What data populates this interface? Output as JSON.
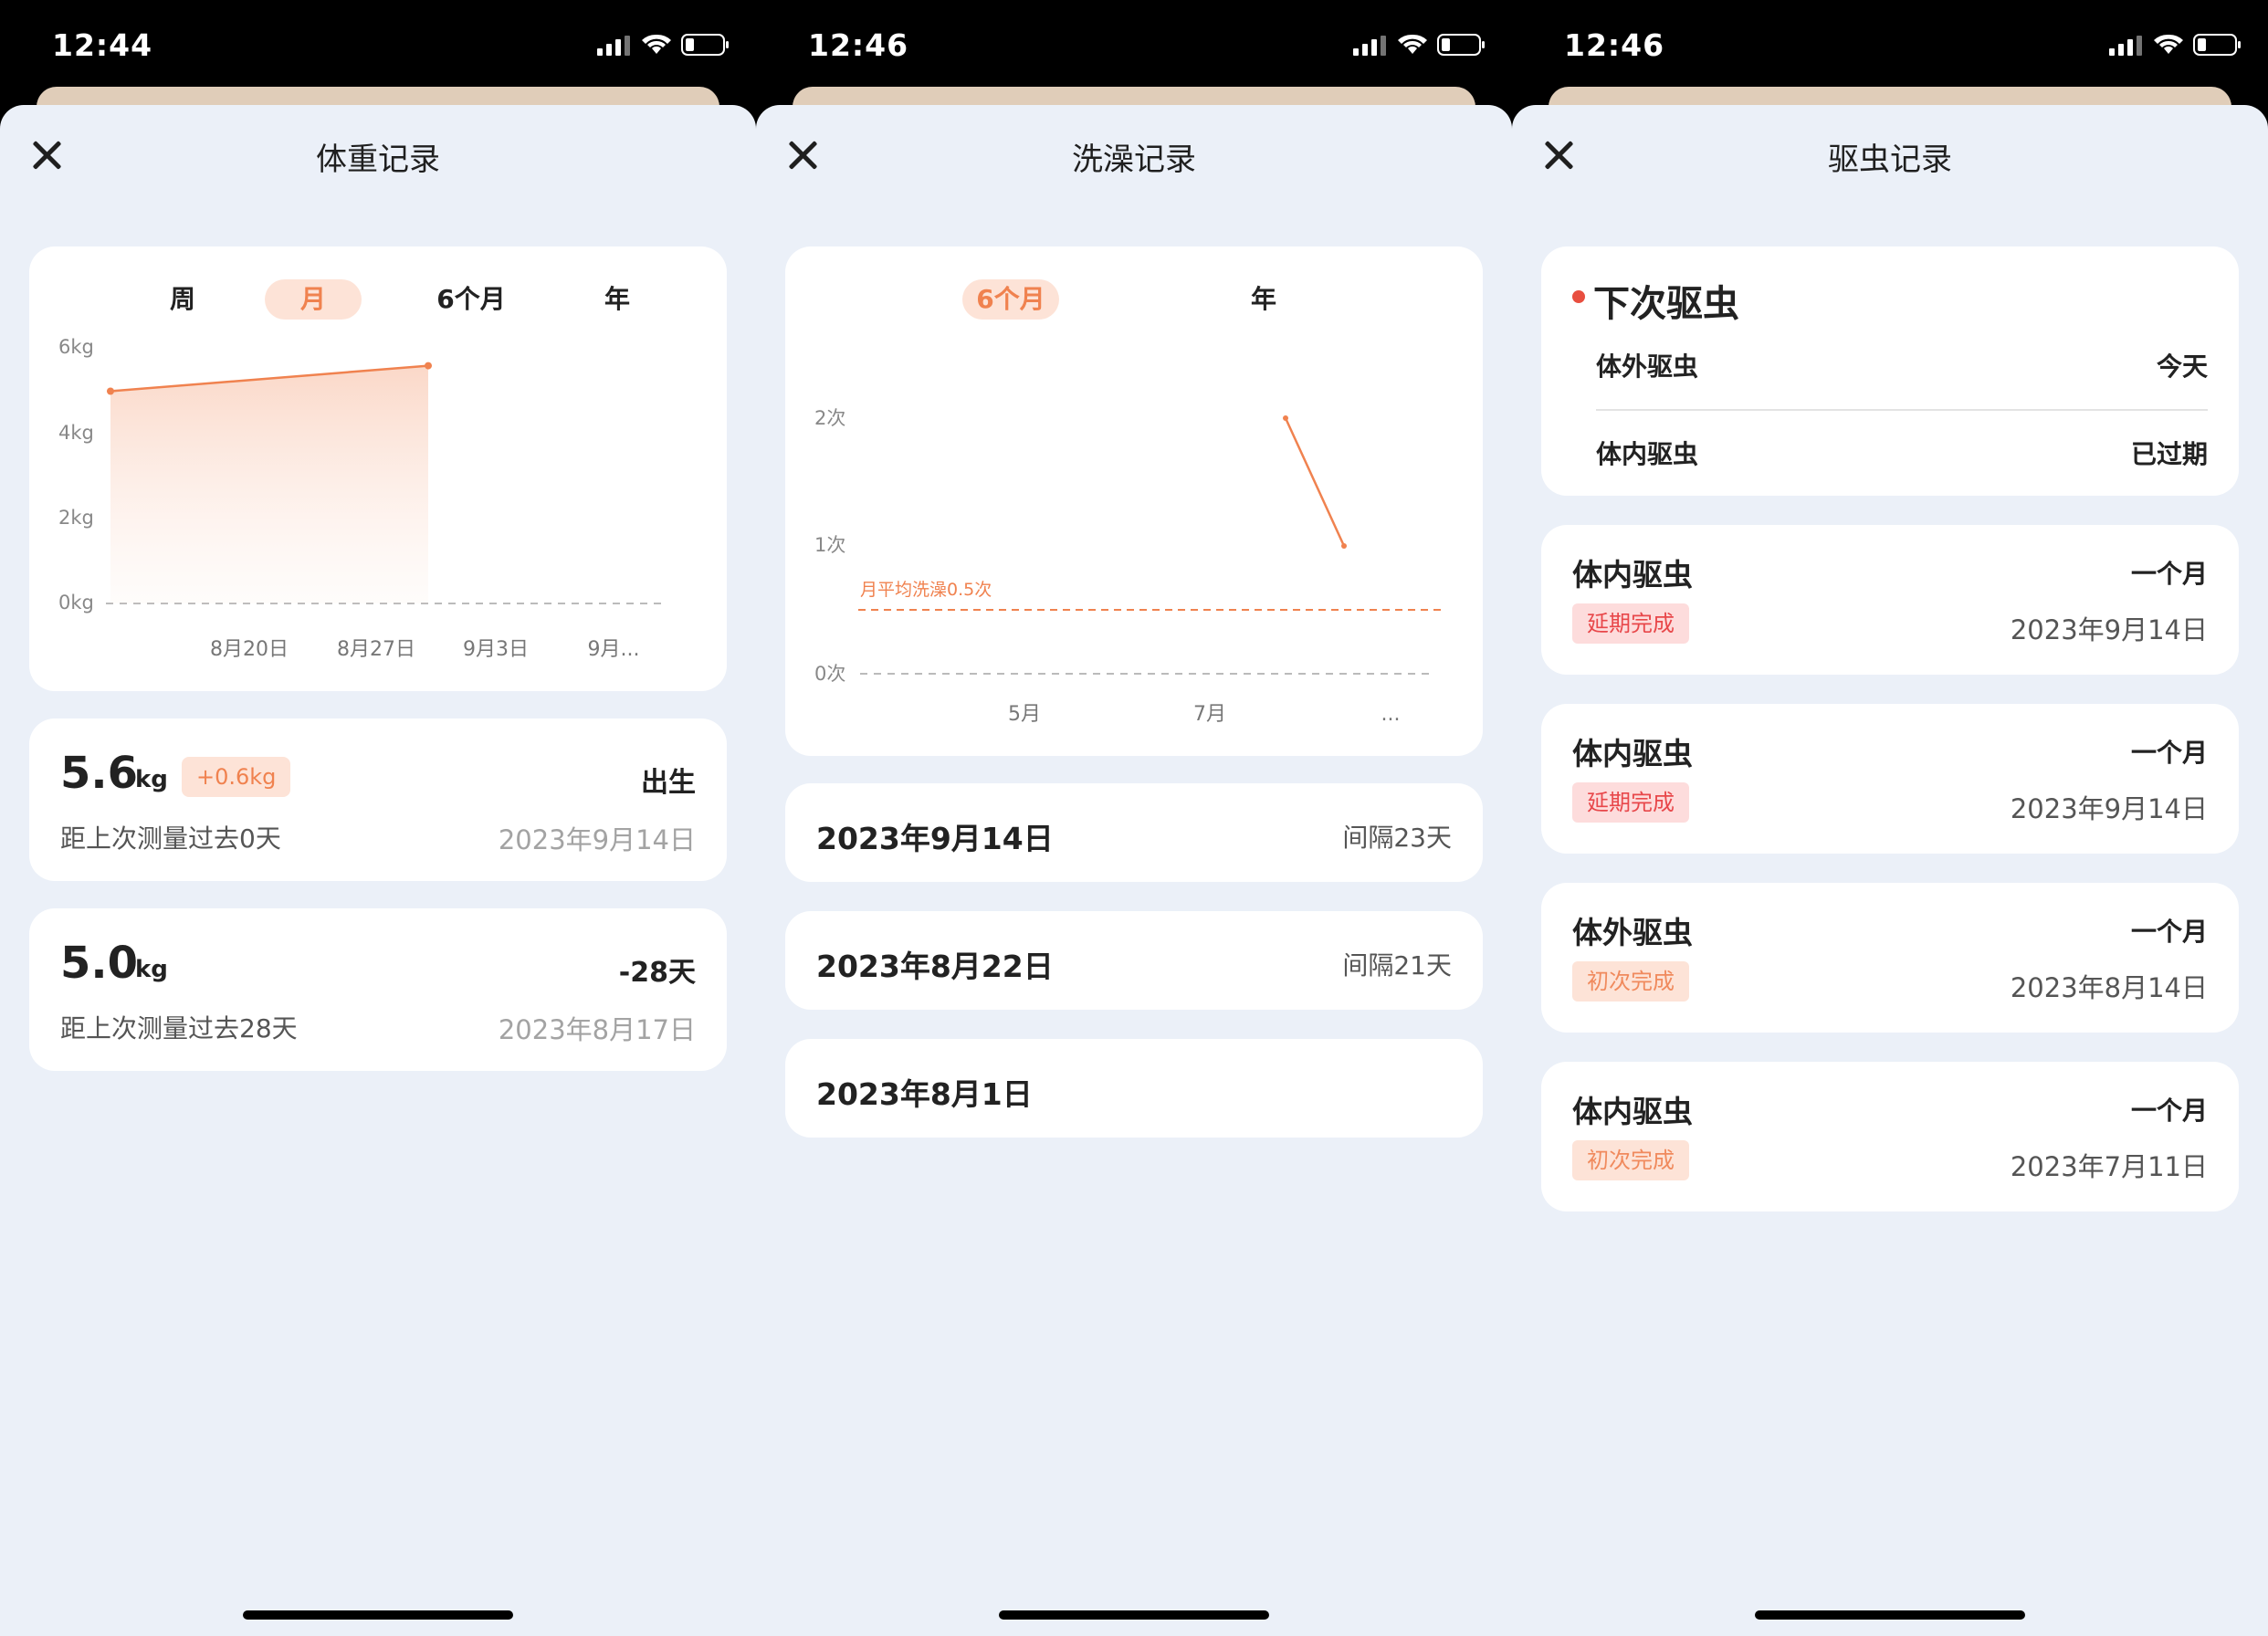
{
  "status": {
    "time1": "12:44",
    "time2": "12:46",
    "time3": "12:46"
  },
  "weight": {
    "title": "体重记录",
    "tabs": [
      "周",
      "月",
      "6个月",
      "年"
    ],
    "active_tab": "月",
    "entries": [
      {
        "value": "5.6",
        "unit": "kg",
        "diff": "+0.6kg",
        "tag": "出生",
        "sub": "距上次测量过去0天",
        "date": "2023年9月14日"
      },
      {
        "value": "5.0",
        "unit": "kg",
        "tag": "-28天",
        "sub": "距上次测量过去28天",
        "date": "2023年8月17日"
      }
    ]
  },
  "bath": {
    "title": "洗澡记录",
    "tabs": [
      "6个月",
      "年"
    ],
    "active_tab": "6个月",
    "records": [
      {
        "date": "2023年9月14日",
        "gap": "间隔23天"
      },
      {
        "date": "2023年8月22日",
        "gap": "间隔21天"
      },
      {
        "date": "2023年8月1日"
      }
    ]
  },
  "deworm": {
    "title": "驱虫记录",
    "next": {
      "heading": "下次驱虫",
      "rows": [
        {
          "k": "体外驱虫",
          "v": "今天"
        },
        {
          "k": "体内驱虫",
          "v": "已过期"
        }
      ]
    },
    "records": [
      {
        "kind": "体内驱虫",
        "period": "一个月",
        "badge": "延期完成",
        "badge_type": "late",
        "date": "2023年9月14日"
      },
      {
        "kind": "体内驱虫",
        "period": "一个月",
        "badge": "延期完成",
        "badge_type": "late",
        "date": "2023年9月14日"
      },
      {
        "kind": "体外驱虫",
        "period": "一个月",
        "badge": "初次完成",
        "badge_type": "first",
        "date": "2023年8月14日"
      },
      {
        "kind": "体内驱虫",
        "period": "一个月",
        "badge": "初次完成",
        "badge_type": "first",
        "date": "2023年7月11日"
      }
    ]
  },
  "chart_data": [
    {
      "type": "area",
      "title": "",
      "xlabel": "",
      "ylabel": "",
      "y_ticks": [
        "6kg",
        "4kg",
        "2kg",
        "0kg"
      ],
      "ylim": [
        0,
        6
      ],
      "x_ticks": [
        "8月20日",
        "8月27日",
        "9月3日",
        "9月..."
      ],
      "series": [
        {
          "points": [
            {
              "x": "2023-08-17",
              "y": 5.0
            },
            {
              "x": "2023-09-14",
              "y": 5.6
            }
          ]
        }
      ],
      "color": "#f0824f"
    },
    {
      "type": "line",
      "title": "",
      "y_ticks": [
        "2次",
        "1次",
        "0次"
      ],
      "ylim": [
        0,
        2
      ],
      "x_ticks": [
        "5月",
        "7月",
        "..."
      ],
      "series": [
        {
          "values": [
            2,
            1
          ]
        }
      ],
      "reference_line": {
        "label": "月平均洗澡0.5次",
        "value": 0.5
      },
      "color": "#f0824f"
    }
  ]
}
